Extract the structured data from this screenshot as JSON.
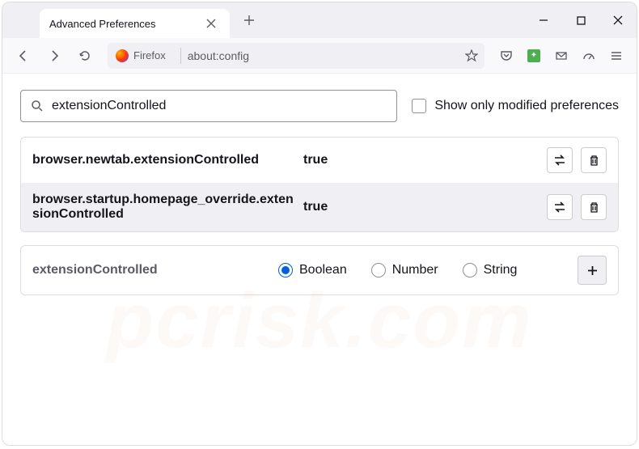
{
  "window": {
    "tab_title": "Advanced Preferences"
  },
  "urlbar": {
    "identity_label": "Firefox",
    "url": "about:config"
  },
  "search": {
    "value": "extensionControlled",
    "checkbox_label": "Show only modified preferences"
  },
  "prefs": [
    {
      "name": "browser.newtab.extensionControlled",
      "value": "true"
    },
    {
      "name": "browser.startup.homepage_override.extensionControlled",
      "value": "true"
    }
  ],
  "new_pref": {
    "name": "extensionControlled",
    "types": [
      "Boolean",
      "Number",
      "String"
    ],
    "selected": 0
  },
  "watermark": "pcrisk.com"
}
